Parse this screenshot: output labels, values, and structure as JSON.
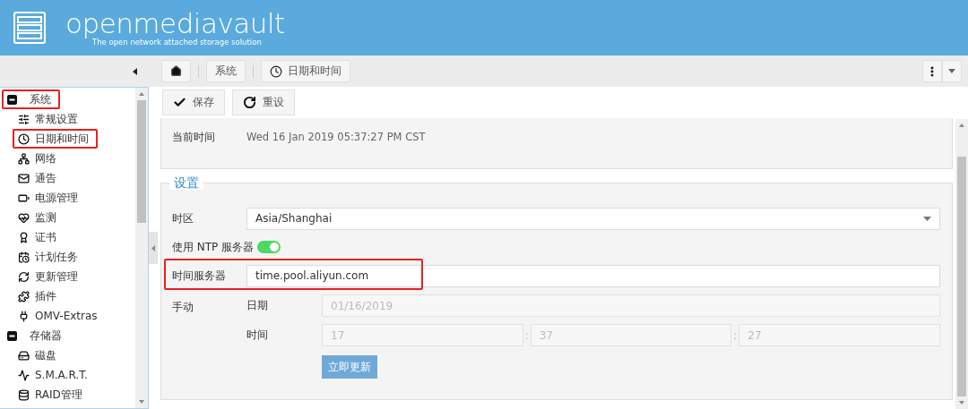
{
  "header": {
    "title": "openmediavault",
    "tagline": "The open network attached storage solution"
  },
  "breadcrumb": [
    {
      "kind": "home"
    },
    {
      "kind": "text",
      "label": "系统"
    },
    {
      "kind": "clock",
      "label": "日期和时间"
    }
  ],
  "sidebar": {
    "items": [
      {
        "label": "系统",
        "expanded": true,
        "highlighted": true,
        "children": [
          {
            "label": "常规设置",
            "highlighted": false
          },
          {
            "label": "日期和时间",
            "highlighted": true
          },
          {
            "label": "网络",
            "highlighted": false
          },
          {
            "label": "通告",
            "highlighted": false
          },
          {
            "label": "电源管理",
            "highlighted": false
          },
          {
            "label": "监测",
            "highlighted": false
          },
          {
            "label": "证书",
            "highlighted": false
          },
          {
            "label": "计划任务",
            "highlighted": false
          },
          {
            "label": "更新管理",
            "highlighted": false
          },
          {
            "label": "插件",
            "highlighted": false
          },
          {
            "label": "OMV-Extras",
            "highlighted": false
          }
        ]
      },
      {
        "label": "存储器",
        "expanded": true,
        "highlighted": false,
        "children": [
          {
            "label": "磁盘",
            "highlighted": false
          },
          {
            "label": "S.M.A.R.T.",
            "highlighted": false
          },
          {
            "label": "RAID管理",
            "highlighted": false
          }
        ]
      }
    ]
  },
  "toolbar": [
    {
      "kind": "save",
      "label": "保存"
    },
    {
      "kind": "reset",
      "label": "重设"
    }
  ],
  "current_time": {
    "label": "当前时间",
    "value": "Wed 16 Jan 2019 05:37:27 PM CST"
  },
  "settings": {
    "legend": "设置",
    "timezone": {
      "label": "时区",
      "value": "Asia/Shanghai"
    },
    "ntp": {
      "label": "使用 NTP 服务器",
      "on": true
    },
    "time_server": {
      "label": "时间服务器",
      "value": "time.pool.aliyun.com",
      "highlighted": true
    },
    "manual": {
      "label": "手动",
      "disabled": true,
      "date": {
        "label": "日期",
        "value": "01/16/2019"
      },
      "time": {
        "label": "时间",
        "fields": [
          "17",
          "37",
          "27"
        ],
        "separators": [
          ":",
          ":"
        ]
      },
      "button": "立即更新"
    }
  }
}
